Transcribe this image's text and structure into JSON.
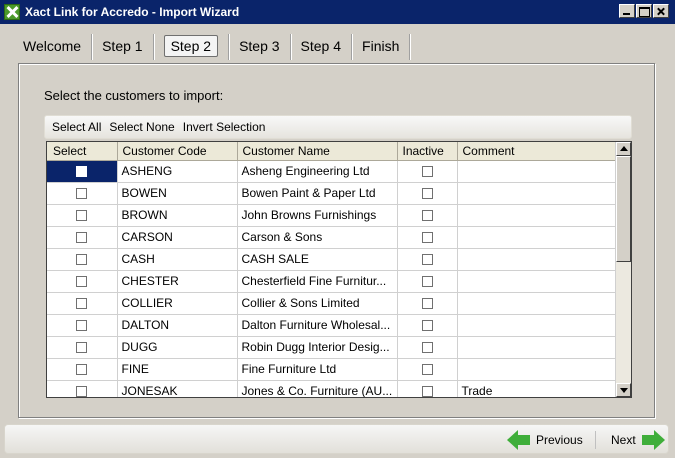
{
  "window": {
    "title": "Xact Link for Accredo - Import Wizard"
  },
  "tabs": [
    {
      "label": "Welcome"
    },
    {
      "label": "Step 1"
    },
    {
      "label": "Step 2",
      "active": true
    },
    {
      "label": "Step 3"
    },
    {
      "label": "Step 4"
    },
    {
      "label": "Finish"
    }
  ],
  "instruction": "Select the customers to import:",
  "toolbar": {
    "select_all": "Select All",
    "select_none": "Select None",
    "invert": "Invert Selection"
  },
  "grid": {
    "columns": [
      "Select",
      "Customer Code",
      "Customer Name",
      "Inactive",
      "Comment"
    ],
    "rows": [
      {
        "code": "ASHENG",
        "name": "Asheng Engineering Ltd",
        "comment": ""
      },
      {
        "code": "BOWEN",
        "name": "Bowen Paint & Paper Ltd",
        "comment": ""
      },
      {
        "code": "BROWN",
        "name": "John Browns Furnishings",
        "comment": ""
      },
      {
        "code": "CARSON",
        "name": "Carson & Sons",
        "comment": ""
      },
      {
        "code": "CASH",
        "name": "CASH SALE",
        "comment": ""
      },
      {
        "code": "CHESTER",
        "name": "Chesterfield Fine Furnitur...",
        "comment": ""
      },
      {
        "code": "COLLIER",
        "name": "Collier & Sons Limited",
        "comment": ""
      },
      {
        "code": "DALTON",
        "name": "Dalton Furniture Wholesal...",
        "comment": ""
      },
      {
        "code": "DUGG",
        "name": "Robin Dugg Interior Desig...",
        "comment": ""
      },
      {
        "code": "FINE",
        "name": "Fine Furniture Ltd",
        "comment": ""
      },
      {
        "code": "JONESAK",
        "name": "Jones & Co. Furniture (AU...",
        "comment": "Trade"
      }
    ]
  },
  "nav": {
    "previous": "Previous",
    "next": "Next"
  },
  "colors": {
    "titlebar": "#0a246a",
    "selection": "#0a246a",
    "arrow": "#3fae3a"
  }
}
